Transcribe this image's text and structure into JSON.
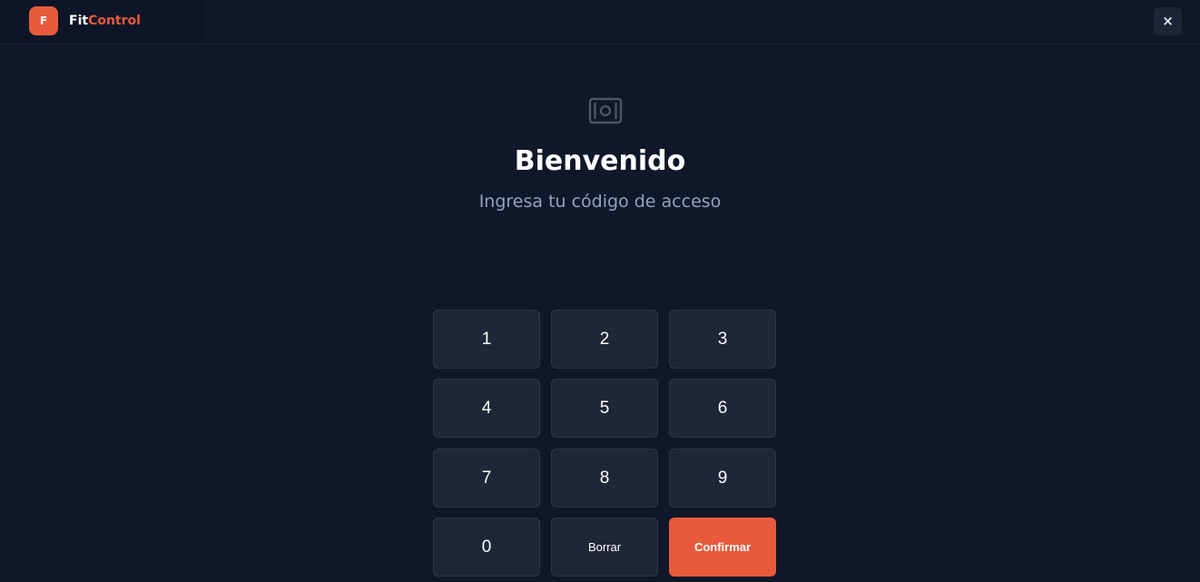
{
  "header": {
    "logo_letter": "F",
    "brand_part1": "Fit",
    "brand_part2": "Control",
    "close_label": "×"
  },
  "main": {
    "icon": "camera-frame-icon",
    "title": "Bienvenido",
    "subtitle": "Ingresa tu código de acceso"
  },
  "keypad": {
    "keys": [
      "1",
      "2",
      "3",
      "4",
      "5",
      "6",
      "7",
      "8",
      "9",
      "0"
    ],
    "delete_label": "Borrar",
    "confirm_label": "Confirmar"
  },
  "colors": {
    "background": "#0f172a",
    "accent": "#e85a3c",
    "key_background": "#1e2637",
    "muted_text": "#94a3b8"
  }
}
